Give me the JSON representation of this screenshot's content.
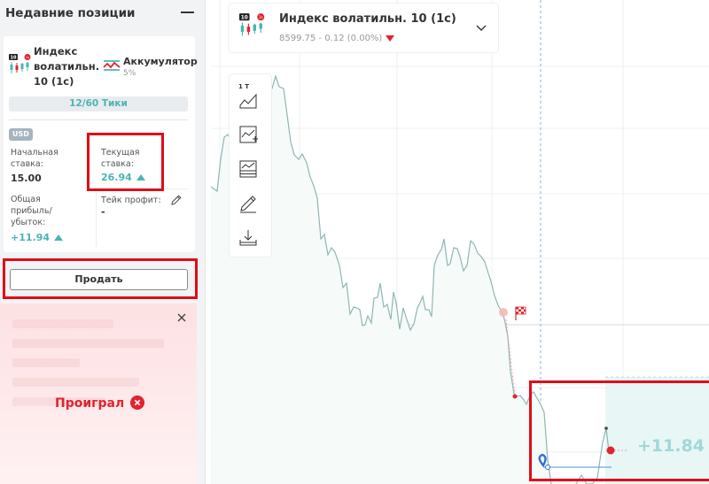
{
  "sidebar": {
    "title": "Недавние позиции",
    "card": {
      "market_name": "Индекс волатильн. 10 (1с)",
      "market_icon_badge": "10",
      "market_icon_sub": "1s",
      "contract_type": "Аккумулятор",
      "contract_growth": "5%",
      "ticks": "12/60 Тики",
      "currency": "USD",
      "buy_price_label": "Начальная ставка:",
      "buy_price": "15.00",
      "current_stake_label": "Текущая ставка:",
      "current_stake": "26.94",
      "total_profit_label": "Общая прибыль/ убыток:",
      "total_profit": "+11.94",
      "take_profit_label": "Тейк профит:",
      "take_profit": "-"
    },
    "sell_button": "Продать",
    "result": {
      "text": "Проиграл"
    }
  },
  "chart": {
    "market_name": "Индекс волатильн. 10 (1с)",
    "quote": "8599.75 - 0.12 (0.00%)",
    "toolbar_interval": "1 T",
    "profit_label": "+11.84"
  },
  "colors": {
    "accent": "#4bb4b3",
    "loss": "#e0242f",
    "highlight": "#e10b17",
    "chart_line": "#8fb6b5"
  },
  "icons": [
    "chart-type-icon",
    "indicators-icon",
    "templates-icon",
    "drawing-tools-icon",
    "download-icon",
    "pencil-icon",
    "close-icon",
    "chevron-down-icon",
    "accumulator-icon",
    "finish-flag-icon",
    "entry-marker-icon"
  ]
}
